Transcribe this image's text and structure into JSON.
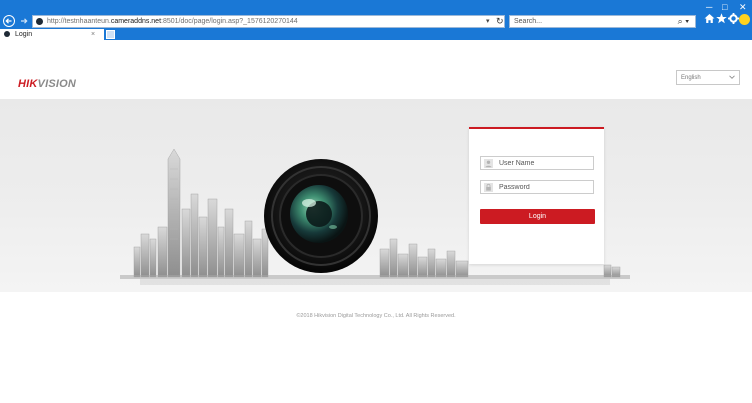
{
  "browser": {
    "window_controls": {
      "minimize": "─",
      "maximize": "□",
      "close": "✕"
    },
    "address": {
      "url_prefix": "http://testnhaanteun.",
      "url_domain": "cameraddns.net",
      "url_suffix": ":8501/doc/page/login.asp?_1576120270144",
      "dropdown": "▾",
      "refresh": "↻"
    },
    "search": {
      "placeholder": "Search...",
      "icon": "⌕ ▾"
    },
    "tab": {
      "title": "Login",
      "close": "×"
    },
    "icons": [
      "back-icon",
      "forward-icon",
      "home-icon",
      "favorites-star-icon",
      "settings-gear-icon",
      "feedback-smiley-icon"
    ]
  },
  "header": {
    "logo_mark": "HIK",
    "logo_rest": "VISION",
    "language": "English"
  },
  "login": {
    "username_placeholder": "User Name",
    "password_placeholder": "Password",
    "button_label": "Login"
  },
  "footer": {
    "copyright": "©2018 Hikvision Digital Technology Co., Ltd. All Rights Reserved."
  },
  "colors": {
    "chrome_blue": "#1a78d6",
    "brand_red": "#cc1b22",
    "banner_gray": "#ececec"
  }
}
